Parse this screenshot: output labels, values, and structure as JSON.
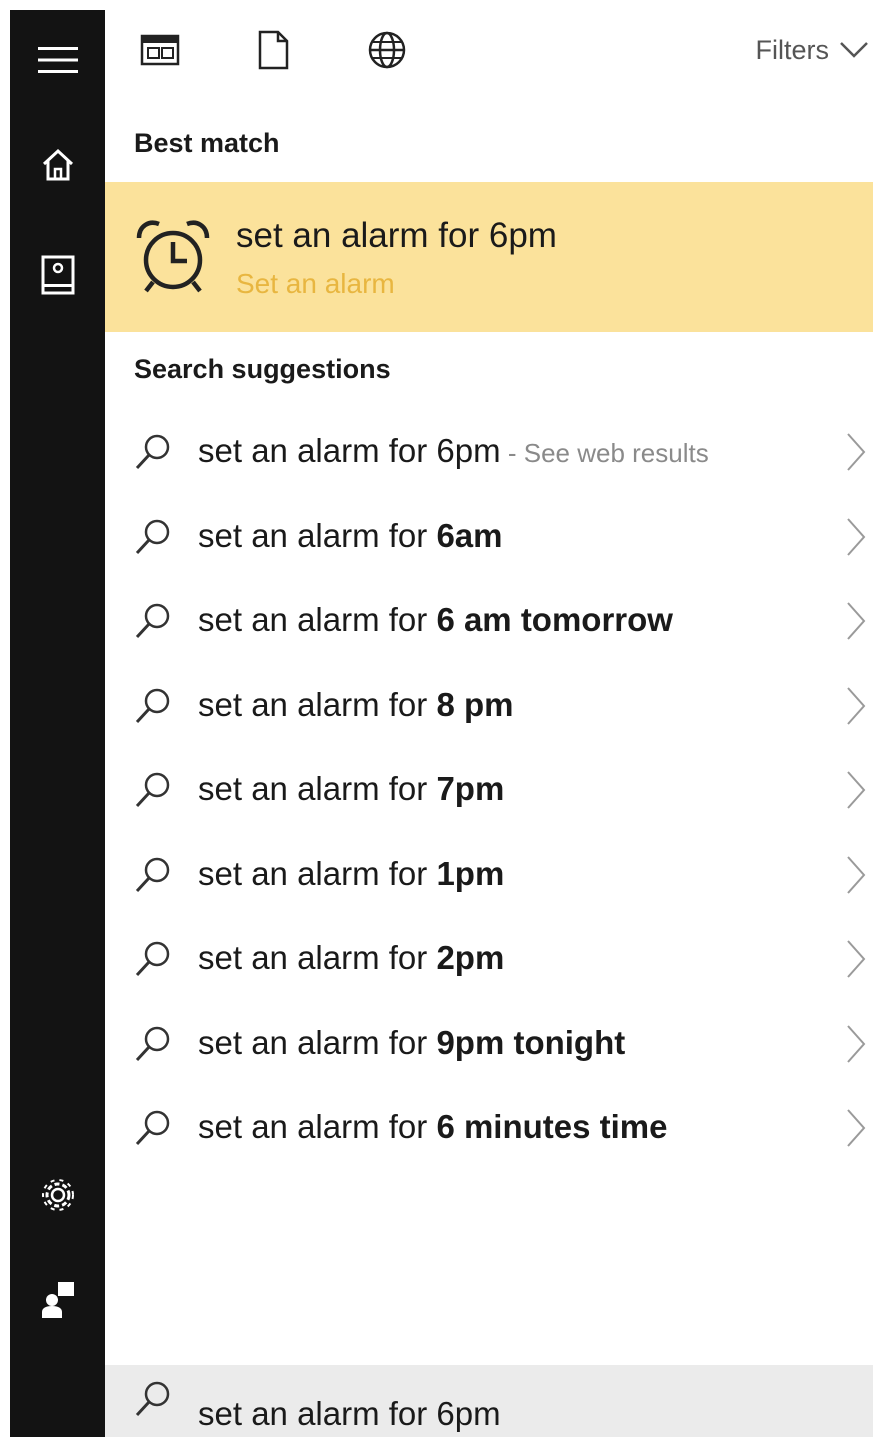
{
  "sidebar": {
    "items": [
      {
        "icon": "hamburger-menu-icon"
      },
      {
        "icon": "home-icon"
      },
      {
        "icon": "notebook-icon"
      },
      {
        "icon": "gear-icon"
      },
      {
        "icon": "feedback-icon"
      }
    ]
  },
  "topbar": {
    "icons": [
      "apps-icon",
      "document-icon",
      "web-globe-icon"
    ],
    "filters_label": "Filters"
  },
  "best_match": {
    "heading": "Best match",
    "title": "set an alarm for 6pm",
    "subtitle": "Set an alarm",
    "icon": "alarm-clock-icon",
    "highlight_color": "#fbe29b",
    "subtitle_color": "#e8b640"
  },
  "search_suggestions": {
    "heading": "Search suggestions",
    "items": [
      {
        "prefix": "set an alarm for 6pm",
        "bold": "",
        "hint": " - See web results"
      },
      {
        "prefix": "set an alarm for ",
        "bold": "6am",
        "hint": ""
      },
      {
        "prefix": "set an alarm for ",
        "bold": "6 am tomorrow",
        "hint": ""
      },
      {
        "prefix": "set an alarm for ",
        "bold": "8 pm",
        "hint": ""
      },
      {
        "prefix": "set an alarm for ",
        "bold": "7pm",
        "hint": ""
      },
      {
        "prefix": "set an alarm for ",
        "bold": "1pm",
        "hint": ""
      },
      {
        "prefix": "set an alarm for ",
        "bold": "2pm",
        "hint": ""
      },
      {
        "prefix": "set an alarm for ",
        "bold": "9pm tonight",
        "hint": ""
      },
      {
        "prefix": "set an alarm for ",
        "bold": "6 minutes time",
        "hint": ""
      }
    ]
  },
  "search_box": {
    "value": "set an alarm for 6pm"
  }
}
